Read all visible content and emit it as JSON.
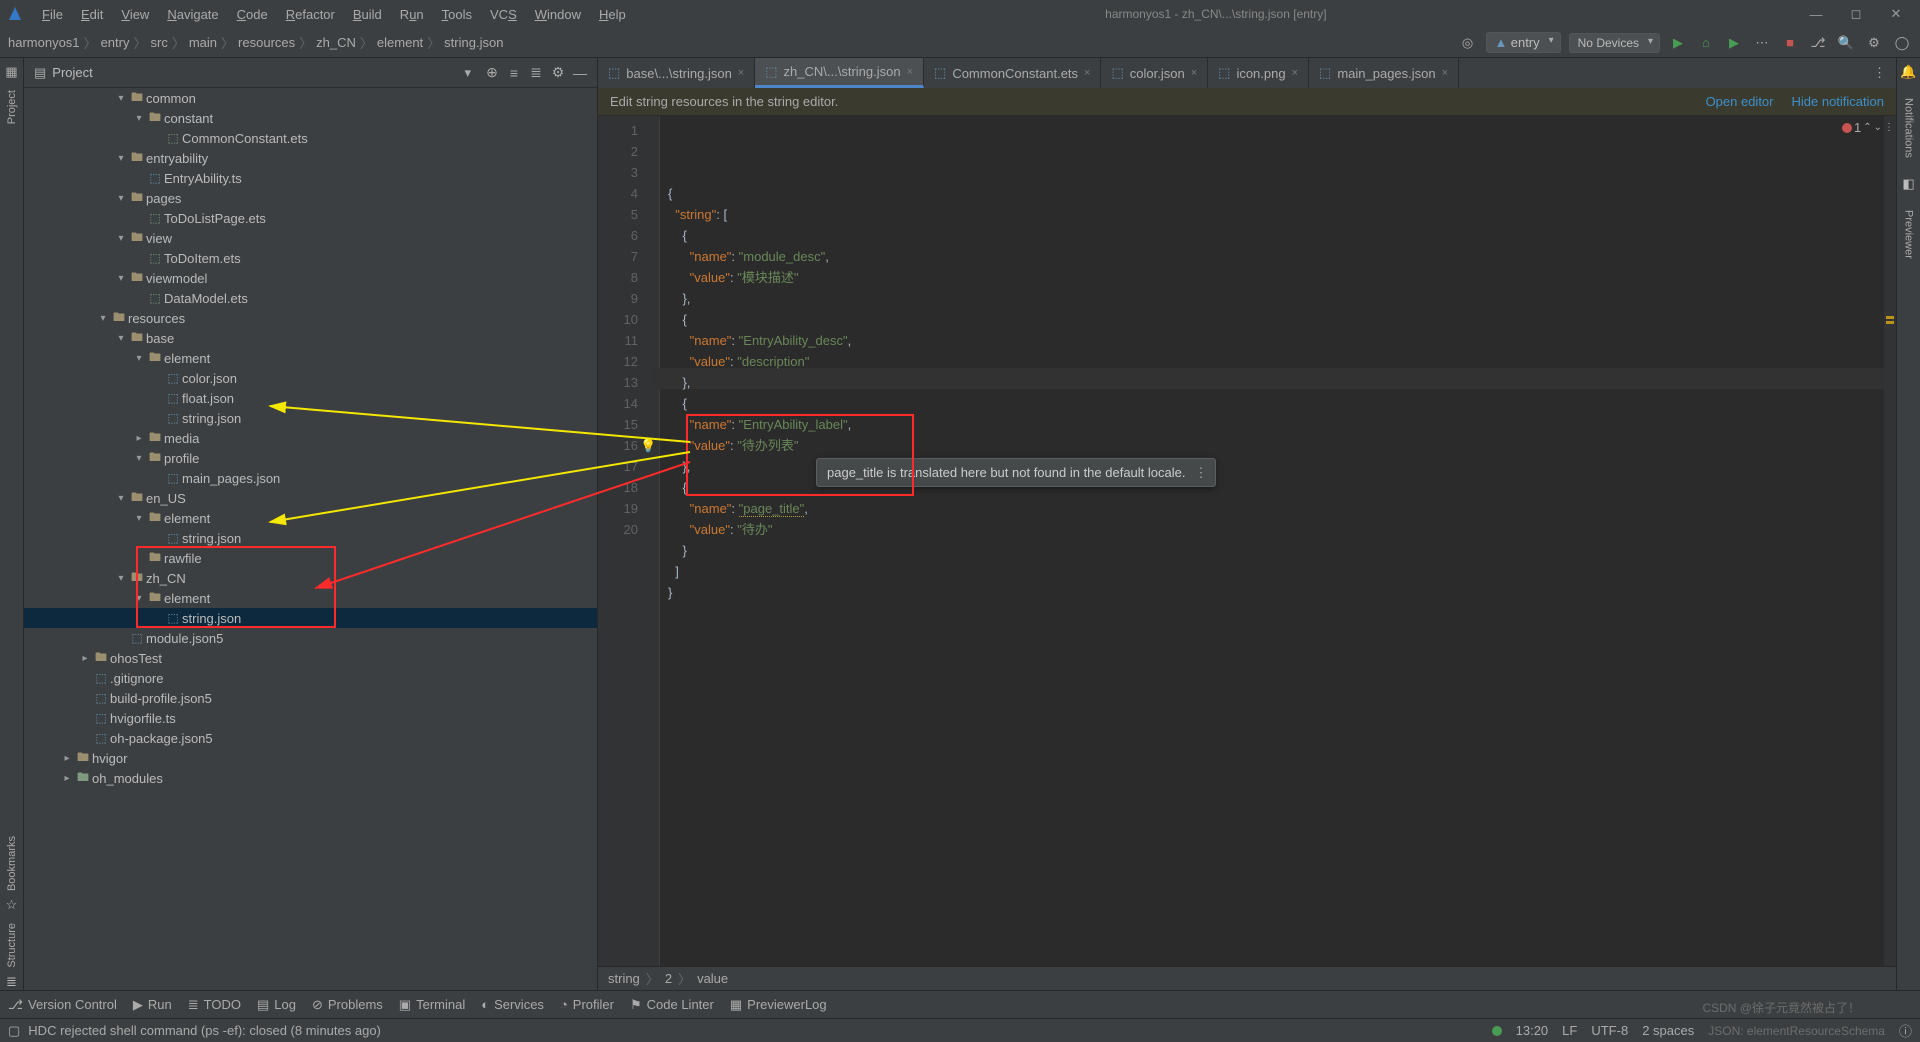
{
  "window": {
    "title": "harmonyos1 - zh_CN\\...\\string.json [entry]"
  },
  "menu": {
    "file": "File",
    "edit": "Edit",
    "view": "View",
    "navigate": "Navigate",
    "code": "Code",
    "refactor": "Refactor",
    "build": "Build",
    "run": "Run",
    "tools": "Tools",
    "vcs": "VCS",
    "window": "Window",
    "help": "Help"
  },
  "breadcrumbs": [
    "harmonyos1",
    "entry",
    "src",
    "main",
    "resources",
    "zh_CN",
    "element",
    "string.json"
  ],
  "nav_right": {
    "build_combo": "entry",
    "device_combo": "No Devices"
  },
  "project": {
    "panel_title": "Project",
    "tree": [
      {
        "d": 4,
        "t": "▾",
        "i": "folder",
        "name": "common"
      },
      {
        "d": 5,
        "t": "▾",
        "i": "folder",
        "name": "constant"
      },
      {
        "d": 6,
        "t": "",
        "i": "ets",
        "name": "CommonConstant.ets"
      },
      {
        "d": 4,
        "t": "▾",
        "i": "folder",
        "name": "entryability"
      },
      {
        "d": 5,
        "t": "",
        "i": "ts",
        "name": "EntryAbility.ts"
      },
      {
        "d": 4,
        "t": "▾",
        "i": "folder",
        "name": "pages"
      },
      {
        "d": 5,
        "t": "",
        "i": "ets",
        "name": "ToDoListPage.ets"
      },
      {
        "d": 4,
        "t": "▾",
        "i": "folder",
        "name": "view"
      },
      {
        "d": 5,
        "t": "",
        "i": "ets",
        "name": "ToDoItem.ets"
      },
      {
        "d": 4,
        "t": "▾",
        "i": "folder",
        "name": "viewmodel"
      },
      {
        "d": 5,
        "t": "",
        "i": "ets",
        "name": "DataModel.ets"
      },
      {
        "d": 3,
        "t": "▾",
        "i": "folder",
        "name": "resources"
      },
      {
        "d": 4,
        "t": "▾",
        "i": "folder",
        "name": "base"
      },
      {
        "d": 5,
        "t": "▾",
        "i": "folder",
        "name": "element"
      },
      {
        "d": 6,
        "t": "",
        "i": "json",
        "name": "color.json"
      },
      {
        "d": 6,
        "t": "",
        "i": "json",
        "name": "float.json"
      },
      {
        "d": 6,
        "t": "",
        "i": "json",
        "name": "string.json"
      },
      {
        "d": 5,
        "t": "▸",
        "i": "folder",
        "name": "media"
      },
      {
        "d": 5,
        "t": "▾",
        "i": "folder",
        "name": "profile"
      },
      {
        "d": 6,
        "t": "",
        "i": "json",
        "name": "main_pages.json"
      },
      {
        "d": 4,
        "t": "▾",
        "i": "folder",
        "name": "en_US"
      },
      {
        "d": 5,
        "t": "▾",
        "i": "folder",
        "name": "element"
      },
      {
        "d": 6,
        "t": "",
        "i": "json",
        "name": "string.json"
      },
      {
        "d": 5,
        "t": "",
        "i": "folder",
        "name": "rawfile"
      },
      {
        "d": 4,
        "t": "▾",
        "i": "folder",
        "name": "zh_CN"
      },
      {
        "d": 5,
        "t": "▾",
        "i": "folder",
        "name": "element"
      },
      {
        "d": 6,
        "t": "",
        "i": "json",
        "name": "string.json",
        "sel": true
      },
      {
        "d": 4,
        "t": "",
        "i": "json",
        "name": "module.json5"
      },
      {
        "d": 2,
        "t": "▸",
        "i": "folder",
        "name": "ohosTest"
      },
      {
        "d": 2,
        "t": "",
        "i": "json",
        "name": ".gitignore"
      },
      {
        "d": 2,
        "t": "",
        "i": "json",
        "name": "build-profile.json5"
      },
      {
        "d": 2,
        "t": "",
        "i": "ts",
        "name": "hvigorfile.ts"
      },
      {
        "d": 2,
        "t": "",
        "i": "json",
        "name": "oh-package.json5"
      },
      {
        "d": 1,
        "t": "▸",
        "i": "folder",
        "name": "hvigor"
      },
      {
        "d": 1,
        "t": "▸",
        "i": "pkg",
        "name": "oh_modules"
      }
    ]
  },
  "tabs": [
    {
      "label": "base\\...\\string.json"
    },
    {
      "label": "zh_CN\\...\\string.json",
      "active": true
    },
    {
      "label": "CommonConstant.ets"
    },
    {
      "label": "color.json"
    },
    {
      "label": "icon.png"
    },
    {
      "label": "main_pages.json"
    }
  ],
  "banner": {
    "text": "Edit string resources in the string editor.",
    "open": "Open editor",
    "hide": "Hide notification"
  },
  "code_lines": {
    "l1": "{",
    "l2a": "  \"string\"",
    "l2b": ": [",
    "l3": "    {",
    "l4a": "      \"name\"",
    "l4b": ": ",
    "l4c": "\"module_desc\"",
    "l4d": ",",
    "l5a": "      \"value\"",
    "l5b": ": ",
    "l5c": "\"模块描述\"",
    "l6": "    },",
    "l7": "    {",
    "l8a": "      \"name\"",
    "l8b": ": ",
    "l8c": "\"EntryAbility_desc\"",
    "l8d": ",",
    "l9a": "      \"value\"",
    "l9b": ": ",
    "l9c": "\"description\"",
    "l10": "    },",
    "l11": "    {",
    "l12a": "      \"name\"",
    "l12b": ": ",
    "l12c": "\"EntryAbility_label\"",
    "l12d": ",",
    "l13a": "      \"value\"",
    "l13b": ": ",
    "l13c": "\"待办列表\"",
    "l14": "    },",
    "l15": "    {",
    "l16a": "      \"name\"",
    "l16b": ": ",
    "l16c": "\"page_title\"",
    "l16d": ",",
    "l17a": "      \"value\"",
    "l17b": ": ",
    "l17c": "\"待办\"",
    "l18": "    }",
    "l19": "  ]",
    "l20": "}"
  },
  "line_count": 20,
  "tooltip": {
    "text": "page_title is translated here but not found in the default locale."
  },
  "editor_crumb": [
    "string",
    "2",
    "value"
  ],
  "error_count": "1",
  "toolstrip": {
    "vc": "Version Control",
    "run": "Run",
    "todo": "TODO",
    "log": "Log",
    "problems": "Problems",
    "terminal": "Terminal",
    "services": "Services",
    "profiler": "Profiler",
    "codelinter": "Code Linter",
    "previewer": "PreviewerLog"
  },
  "status": {
    "left": "HDC rejected shell command (ps -ef): closed (8 minutes ago)",
    "pos": "13:20",
    "le": "LF",
    "enc": "UTF-8",
    "indent": "2 spaces",
    "schema": "JSON: elementResourceSchema",
    "watermark": "CSDN @徐子元竟然被占了！"
  },
  "side_labels": {
    "project": "Project",
    "bookmarks": "Bookmarks",
    "structure": "Structure",
    "notifications": "Notifications",
    "previewer": "Previewer"
  }
}
